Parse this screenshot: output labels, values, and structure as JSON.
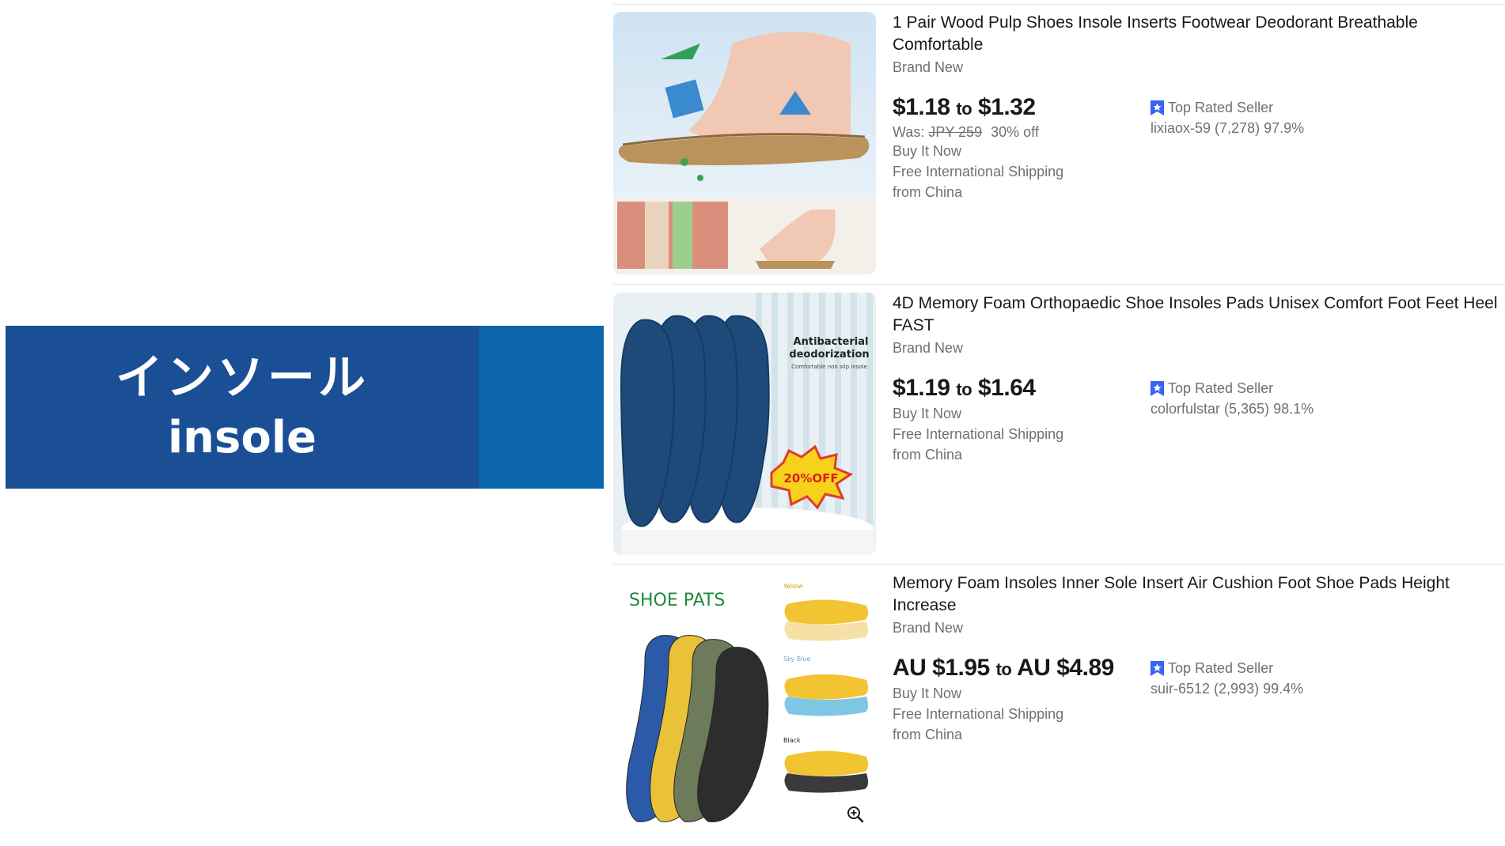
{
  "banner": {
    "japanese": "インソール",
    "english": "insole"
  },
  "listings": [
    {
      "title": "1 Pair Wood Pulp Shoes Insole Inserts Footwear Deodorant Breathable Comfortable",
      "condition": "Brand New",
      "price_from": "$1.18",
      "price_to_word": "to",
      "price_to": "$1.32",
      "was_label": "Was:",
      "was_price": "JPY 259",
      "discount": "30% off",
      "buy_format": "Buy It Now",
      "shipping": "Free International Shipping",
      "origin": "from China",
      "top_rated_label": "Top Rated Seller",
      "seller": "lixiaox-59 (7,278) 97.9%",
      "image_icon": "wood-pulp-insole-photo"
    },
    {
      "title": "4D Memory Foam Orthopaedic Shoe Insoles Pads Unisex Comfort Foot Feet Heel FAST",
      "condition": "Brand New",
      "price_from": "$1.19",
      "price_to_word": "to",
      "price_to": "$1.64",
      "buy_format": "Buy It Now",
      "shipping": "Free International Shipping",
      "origin": "from China",
      "top_rated_label": "Top Rated Seller",
      "seller": "colorfulstar (5,365) 98.1%",
      "image_text_1": "Antibacterial",
      "image_text_2": "deodorization",
      "image_text_3": "Comfortable non slip insole",
      "image_badge": "20%OFF",
      "image_icon": "memory-foam-insole-photo"
    },
    {
      "title": "Memory Foam Insoles Inner Sole Insert Air Cushion Foot Shoe Pads Height Increase",
      "condition": "Brand New",
      "price_from": "AU $1.95",
      "price_to_word": "to",
      "price_to": "AU $4.89",
      "buy_format": "Buy It Now",
      "shipping": "Free International Shipping",
      "origin": "from China",
      "top_rated_label": "Top Rated Seller",
      "seller": "suir-6512 (2,993) 99.4%",
      "image_text_1": "SHOE PATS",
      "swatch_1": "Yellow",
      "swatch_2": "Sky Blue",
      "swatch_3": "Black",
      "image_icon": "shoe-pads-photo"
    }
  ],
  "colors": {
    "banner_blue": "#1a4f96",
    "banner_side": "#0a66a8",
    "top_rated_blue": "#3665f3"
  }
}
